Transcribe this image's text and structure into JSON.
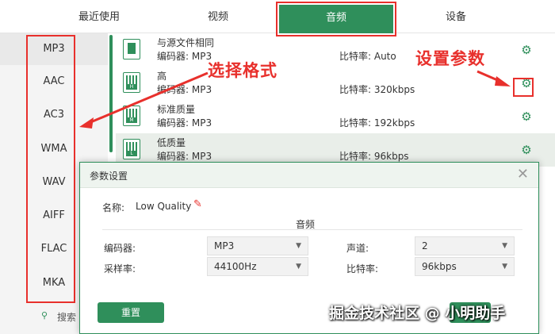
{
  "tabs": [
    "最近使用",
    "视频",
    "音频",
    "设备"
  ],
  "formats": [
    "MP3",
    "AAC",
    "AC3",
    "WMA",
    "WAV",
    "AIFF",
    "FLAC",
    "MKA"
  ],
  "search_label": "搜索",
  "quality_rows": [
    {
      "title": "与源文件相同",
      "encoder": "编码器:   MP3",
      "bitrate": "比特率:   Auto",
      "icon_tag": ""
    },
    {
      "title": "高",
      "encoder": "编码器:   MP3",
      "bitrate": "比特率:   320kbps",
      "icon_tag": "H"
    },
    {
      "title": "标准质量",
      "encoder": "编码器:   MP3",
      "bitrate": "比特率:   192kbps",
      "icon_tag": "M"
    },
    {
      "title": "低质量",
      "encoder": "编码器:   MP3",
      "bitrate": "比特率:   96kbps",
      "icon_tag": "L"
    }
  ],
  "annotations": {
    "select_format": "选择格式",
    "set_params": "设置参数"
  },
  "dialog": {
    "title": "参数设置",
    "name_label": "名称:",
    "name_value": "Low Quality",
    "section": "音频",
    "encoder_label": "编码器:",
    "encoder_value": "MP3",
    "channel_label": "声道:",
    "channel_value": "2",
    "samplerate_label": "采样率:",
    "samplerate_value": "44100Hz",
    "bitrate_label": "比特率:",
    "bitrate_value": "96kbps",
    "reset_label": "重置"
  },
  "watermark": "掘金技术社区 @ 小明助手",
  "colors": {
    "accent": "#2f8f5b",
    "annotation": "#e8302c"
  }
}
